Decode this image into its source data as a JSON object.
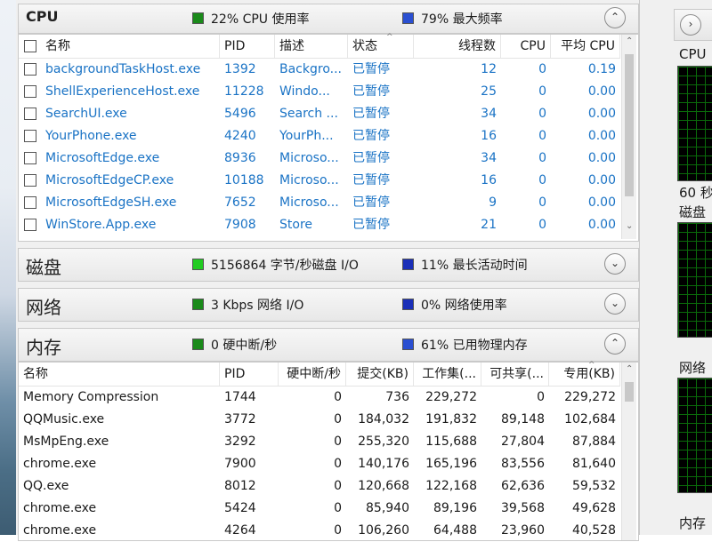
{
  "cpu": {
    "title": "CPU",
    "usage_text": "22% CPU 使用率",
    "freq_text": "79% 最大频率",
    "usage_color": "#1a8a1a",
    "freq_color": "#2a4fd1",
    "toggle_icon": "chevron-up-icon",
    "columns": [
      "名称",
      "PID",
      "描述",
      "状态",
      "线程数",
      "CPU",
      "平均 CPU"
    ],
    "rows": [
      [
        "backgroundTaskHost.exe",
        "1392",
        "Backgro...",
        "已暂停",
        "12",
        "0",
        "0.19"
      ],
      [
        "ShellExperienceHost.exe",
        "11228",
        "Windo...",
        "已暂停",
        "25",
        "0",
        "0.00"
      ],
      [
        "SearchUI.exe",
        "5496",
        "Search ...",
        "已暂停",
        "34",
        "0",
        "0.00"
      ],
      [
        "YourPhone.exe",
        "4240",
        "YourPh...",
        "已暂停",
        "16",
        "0",
        "0.00"
      ],
      [
        "MicrosoftEdge.exe",
        "8936",
        "Microso...",
        "已暂停",
        "34",
        "0",
        "0.00"
      ],
      [
        "MicrosoftEdgeCP.exe",
        "10188",
        "Microso...",
        "已暂停",
        "16",
        "0",
        "0.00"
      ],
      [
        "MicrosoftEdgeSH.exe",
        "7652",
        "Microso...",
        "已暂停",
        "9",
        "0",
        "0.00"
      ],
      [
        "WinStore.App.exe",
        "7908",
        "Store",
        "已暂停",
        "21",
        "0",
        "0.00"
      ]
    ]
  },
  "disk": {
    "title": "磁盘",
    "io_text": "5156864 字节/秒磁盘 I/O",
    "active_text": "11% 最长活动时间",
    "io_color": "#22cc22",
    "active_color": "#1a2fb8",
    "toggle_icon": "chevron-down-icon"
  },
  "network": {
    "title": "网络",
    "io_text": "3 Kbps 网络 I/O",
    "usage_text": "0% 网络使用率",
    "io_color": "#1a8a1a",
    "usage_color": "#1a2fb8",
    "toggle_icon": "chevron-down-icon"
  },
  "memory": {
    "title": "内存",
    "faults_text": "0 硬中断/秒",
    "used_text": "61% 已用物理内存",
    "faults_color": "#1a8a1a",
    "used_color": "#2a4fd1",
    "toggle_icon": "chevron-up-icon",
    "columns": [
      "名称",
      "PID",
      "硬中断/秒",
      "提交(KB)",
      "工作集(...",
      "可共享(...",
      "专用(KB)"
    ],
    "rows": [
      [
        "Memory Compression",
        "1744",
        "0",
        "736",
        "229,272",
        "0",
        "229,272"
      ],
      [
        "QQMusic.exe",
        "3772",
        "0",
        "184,032",
        "191,832",
        "89,148",
        "102,684"
      ],
      [
        "MsMpEng.exe",
        "3292",
        "0",
        "255,320",
        "115,688",
        "27,804",
        "87,884"
      ],
      [
        "chrome.exe",
        "7900",
        "0",
        "140,176",
        "165,196",
        "83,556",
        "81,640"
      ],
      [
        "QQ.exe",
        "8012",
        "0",
        "120,668",
        "122,168",
        "62,636",
        "59,532"
      ],
      [
        "chrome.exe",
        "5424",
        "0",
        "85,940",
        "89,196",
        "39,568",
        "49,628"
      ],
      [
        "chrome.exe",
        "4264",
        "0",
        "106,260",
        "64,488",
        "23,960",
        "40,528"
      ]
    ]
  },
  "side_panel": {
    "expand_icon": "chevron-right-icon",
    "cpu_label": "CPU",
    "time_label": "60 秒",
    "disk_label": "磁盘",
    "network_label": "网络",
    "memory_label": "内存"
  }
}
